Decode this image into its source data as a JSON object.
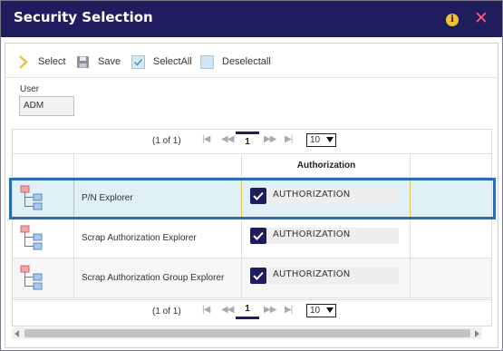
{
  "window": {
    "title": "Security Selection",
    "info_icon": "info-icon",
    "close_icon": "close-icon"
  },
  "toolbar": {
    "select_label": "Select",
    "save_label": "Save",
    "selectall_label": "SelectAll",
    "deselectall_label": "Deselectall"
  },
  "user": {
    "label": "User",
    "value": "ADM"
  },
  "pager": {
    "count": "(1 of 1)",
    "page": "1",
    "page_size": "10"
  },
  "grid": {
    "header_authorization": "Authorization",
    "rows": [
      {
        "name": "P/N Explorer",
        "authorization": "AUTHORIZATION",
        "checked": true,
        "selected": true
      },
      {
        "name": "Scrap Authorization Explorer",
        "authorization": "AUTHORIZATION",
        "checked": true,
        "selected": false
      },
      {
        "name": "Scrap Authorization Group Explorer",
        "authorization": "AUTHORIZATION",
        "checked": true,
        "selected": false
      }
    ]
  },
  "colors": {
    "titlebar": "#1f1d5e",
    "accent": "#1f1d5e",
    "close": "#ff5a6e",
    "info": "#f2c230",
    "selection_border": "#2b6cb0",
    "selected_row": "#dff0f7"
  }
}
